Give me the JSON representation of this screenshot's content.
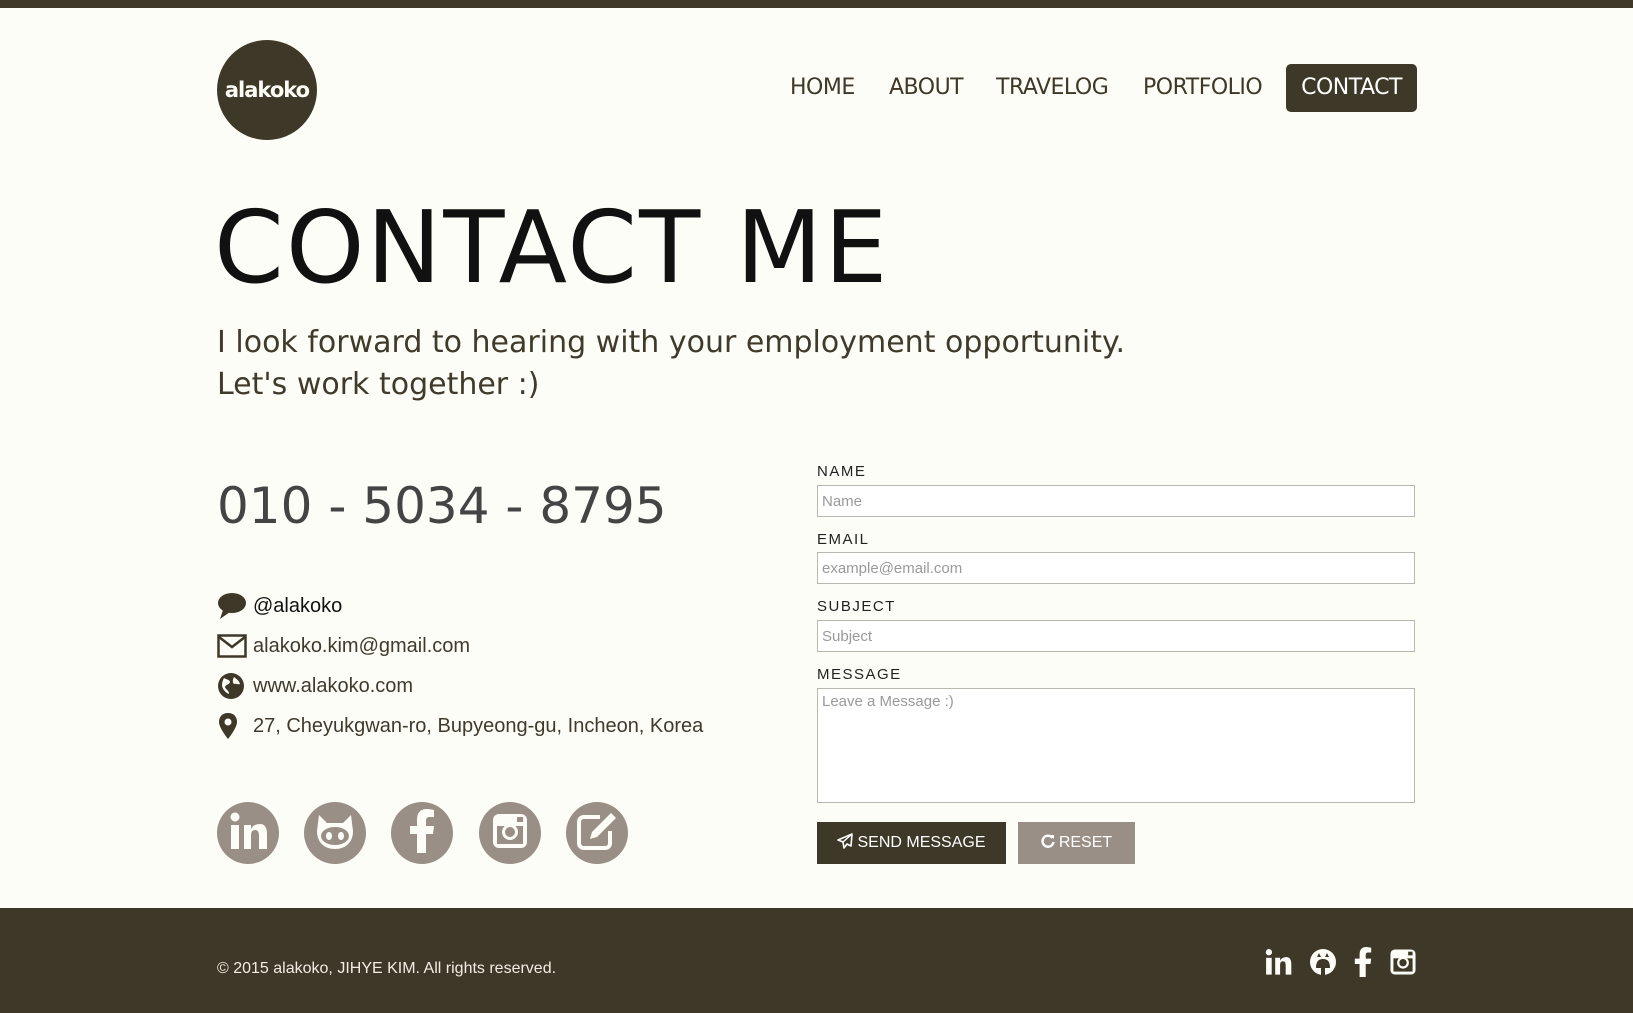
{
  "brand": {
    "logo_text": "alakoko"
  },
  "nav": {
    "items": [
      {
        "label": "HOME"
      },
      {
        "label": "ABOUT"
      },
      {
        "label": "TRAVELOG"
      },
      {
        "label": "PORTFOLIO"
      },
      {
        "label": "CONTACT",
        "active": true
      }
    ]
  },
  "main": {
    "title": "CONTACT ME",
    "intro_line1": "I look forward to hearing with your employment opportunity.",
    "intro_line2": "Let's work together :)",
    "phone": "010 - 5034 - 8795",
    "contacts": [
      {
        "icon": "chat-bubble-icon",
        "text": "@alakoko"
      },
      {
        "icon": "envelope-icon",
        "text": "alakoko.kim@gmail.com"
      },
      {
        "icon": "globe-icon",
        "text": "www.alakoko.com"
      },
      {
        "icon": "map-pin-icon",
        "text": "27, Cheyukgwan-ro, Bupyeong-gu, Incheon, Korea"
      }
    ],
    "social": [
      "linkedin-icon",
      "github-icon",
      "facebook-icon",
      "instagram-icon",
      "blog-edit-icon"
    ]
  },
  "form": {
    "name_label": "NAME",
    "name_placeholder": "Name",
    "name_value": "",
    "email_label": "EMAIL",
    "email_placeholder": "example@email.com",
    "email_value": "",
    "subject_label": "SUBJECT",
    "subject_placeholder": "Subject",
    "subject_value": "",
    "message_label": "MESSAGE",
    "message_placeholder": "Leave a Message :)",
    "message_value": "",
    "send_label": "SEND MESSAGE",
    "reset_label": "RESET"
  },
  "footer": {
    "copyright": "© 2015 alakoko, JIHYE KIM. All rights reserved.",
    "icons": [
      "linkedin-icon",
      "github-icon",
      "facebook-icon",
      "instagram-icon"
    ]
  },
  "colors": {
    "brand_dark": "#3e3828",
    "background": "#fdfdf7",
    "social_circle": "#9a8f86"
  }
}
